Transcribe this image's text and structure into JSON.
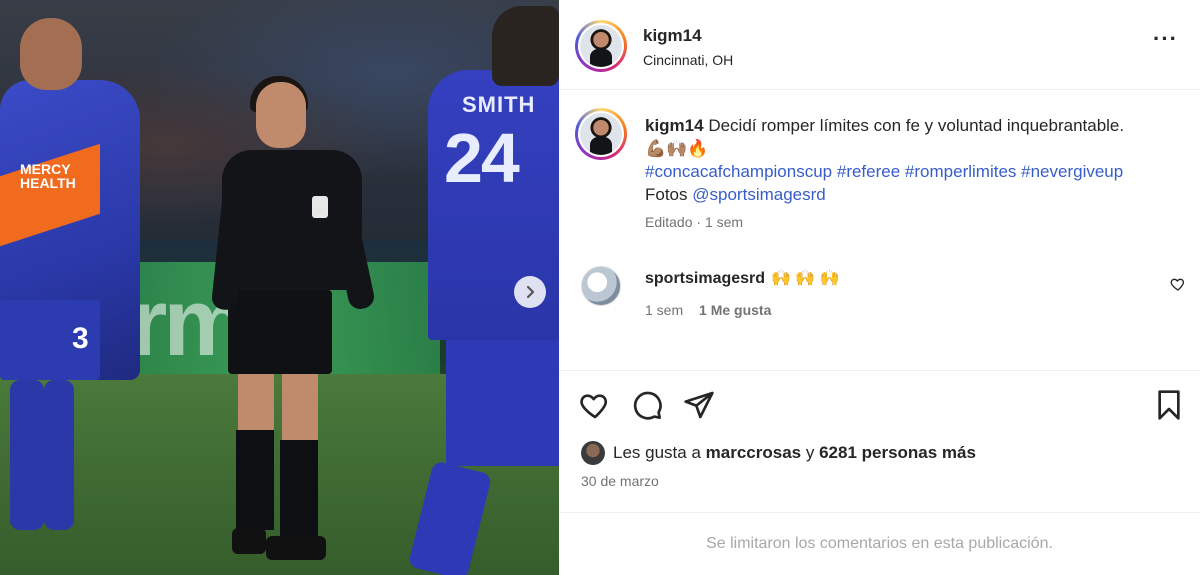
{
  "post": {
    "username": "kigm14",
    "location": "Cincinnati, OH",
    "more_icon": "more-options-icon"
  },
  "caption": {
    "username": "kigm14",
    "text": "Decidí romper límites con fe y voluntad inquebrantable.",
    "emojis": "💪🏽🙌🏽🔥",
    "hashtags": [
      "#concacafchampionscup",
      "#referee",
      "#romperlimites",
      "#nevergiveup"
    ],
    "photos_prefix": "Fotos",
    "photos_mention": "@sportsimagesrd",
    "edited": "Editado",
    "time": "1 sem"
  },
  "comment": {
    "username": "sportsimagesrd",
    "emojis": "🙌 🙌 🙌",
    "time": "1 sem",
    "likes": "1 Me gusta"
  },
  "photo": {
    "player_left_sponsor_1": "MERCY",
    "player_left_sponsor_2": "HEALTH",
    "player_left_number": "3",
    "player_right_name": "SMITH",
    "player_right_number": "24",
    "board_text": "rmi"
  },
  "likes": {
    "prefix": "Les gusta a",
    "user": "marccrosas",
    "middle": "y",
    "count_text": "6281 personas más"
  },
  "date": "30 de marzo",
  "comments_limited": "Se limitaron los comentarios en esta publicación."
}
